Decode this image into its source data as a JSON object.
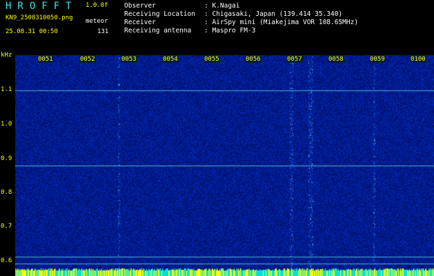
{
  "header": {
    "app_title": "HROFFT",
    "version": "1.0.0f",
    "filename": "KN9_2508310050.png",
    "mode": "meteor",
    "datetime": "25.08.31 00:50",
    "count": "131"
  },
  "station": {
    "labels": [
      "Observer",
      "Receiving Location",
      "Receiver",
      "Receiving antenna"
    ],
    "values": [
      ": K.Nagai",
      ": Chigasaki, Japan (139.414 35.340)",
      ": AirSpy mini (Miakejima VOR 108.65MHz)",
      ": Maspro FM-3"
    ]
  },
  "axis": {
    "unit": "kHz",
    "y_ticks": [
      "1.1",
      "1.0",
      "0.9",
      "0.8",
      "0.7",
      "0.6"
    ],
    "x_ticks": [
      "0051",
      "0052",
      "0053",
      "0054",
      "0055",
      "0056",
      "0057",
      "0058",
      "0059",
      "0100"
    ]
  },
  "colors": {
    "background": "#000000",
    "label": "#ffff00",
    "info": "#39e6e6",
    "spectrogram_base": "#00136e"
  }
}
